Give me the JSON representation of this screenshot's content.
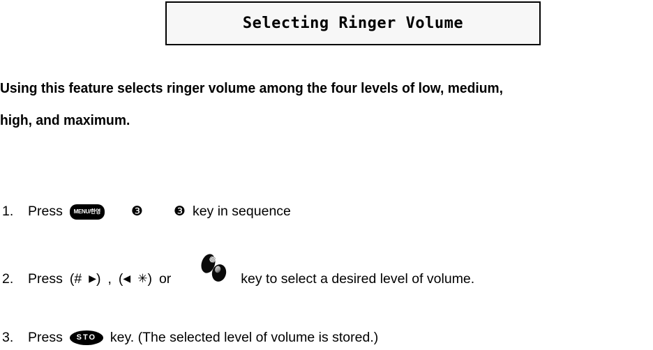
{
  "title": {
    "text": "Selecting Ringer Volume"
  },
  "intro": {
    "lines": [
      "Using this feature selects ringer volume among the four levels of low, medium,",
      "high, and maximum."
    ]
  },
  "steps": [
    {
      "number": "1.",
      "press_label": "Press",
      "menu_key_label": "MENU/한영",
      "circled_three_a": "❸",
      "circled_three_b": "❸",
      "tail_text": "key in sequence"
    },
    {
      "number": "2.",
      "press_label": "Press",
      "hash_group_open": "(#",
      "right_arrow": "▶",
      "hash_group_close": ")",
      "comma": ",",
      "star_group_open": "(",
      "left_arrow": "◀",
      "star_glyph": "✳",
      "star_group_close": ")",
      "or_label": "or",
      "tail_text": "key to select a desired level of volume."
    },
    {
      "number": "3.",
      "press_label": "Press",
      "sto_key_label": "STO",
      "tail_text": "key. (The selected level of volume is stored.)"
    }
  ],
  "colors": {
    "page_background": "#ffffff",
    "title_box_fill": "#f7f7f7",
    "title_box_border": "#000000",
    "text": "#000000",
    "key_fill": "#000000",
    "key_text": "#ffffff"
  }
}
